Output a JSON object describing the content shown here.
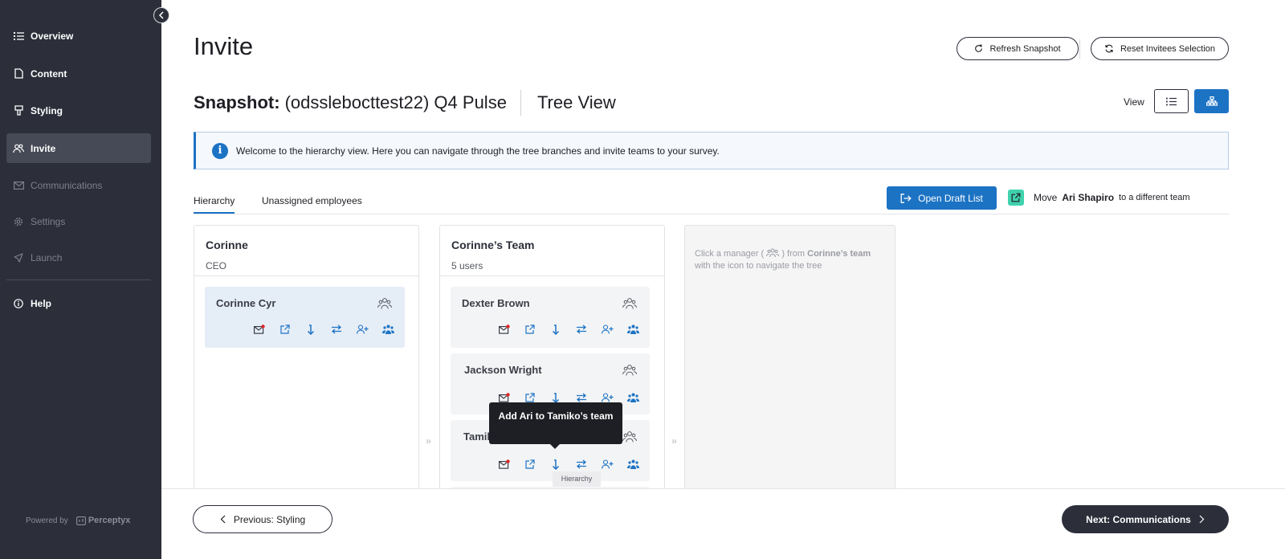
{
  "sidebar": {
    "items": [
      {
        "label": "Overview",
        "icon": "list-icon",
        "state": "normal"
      },
      {
        "label": "Content",
        "icon": "document-icon",
        "state": "normal"
      },
      {
        "label": "Styling",
        "icon": "brush-icon",
        "state": "normal"
      },
      {
        "label": "Invite",
        "icon": "people-icon",
        "state": "active"
      },
      {
        "label": "Communications",
        "icon": "mail-icon",
        "state": "disabled"
      },
      {
        "label": "Settings",
        "icon": "gear-icon",
        "state": "disabled"
      },
      {
        "label": "Launch",
        "icon": "rocket-icon",
        "state": "disabled"
      },
      {
        "label": "Help",
        "icon": "info-icon",
        "state": "normal"
      }
    ],
    "powered_by": "Powered by",
    "brand": "Perceptyx"
  },
  "header": {
    "title": "Invite",
    "refresh_label": "Refresh Snapshot",
    "reset_label": "Reset Invitees Selection"
  },
  "snapshot": {
    "label": "Snapshot:",
    "name": "(odsslebocttest22) Q4 Pulse",
    "view_name": "Tree View"
  },
  "view_toggle": {
    "label": "View",
    "selected": "tree"
  },
  "banner": {
    "text": "Welcome to the hierarchy view. Here you can navigate through the tree branches and invite teams to your survey."
  },
  "tabs": [
    {
      "label": "Hierarchy",
      "active": true
    },
    {
      "label": "Unassigned employees",
      "active": false
    }
  ],
  "draft_button": {
    "label": "Open Draft List"
  },
  "move": {
    "prefix": "Move",
    "name": "Ari Shapiro",
    "suffix": "to a different team"
  },
  "columns": [
    {
      "title": "Corinne",
      "subtitle": "CEO",
      "cards": [
        {
          "name": "Corinne Cyr",
          "selected": true
        }
      ]
    },
    {
      "title": "Corinne’s Team",
      "subtitle": "5 users",
      "cards": [
        {
          "name": "Dexter Brown",
          "selected": false
        },
        {
          "name": "Jackson Wright",
          "selected": false
        },
        {
          "name": "Tamiko",
          "selected": false
        }
      ]
    }
  ],
  "placeholder": {
    "part1": "Click a manager (",
    "part2": ") from",
    "bold": "Corinne’s team",
    "part3": "with the icon to navigate the tree"
  },
  "tooltip": {
    "text": "Add Ari to Tamiko’s team",
    "hint": "Hierarchy"
  },
  "footer": {
    "prev_label": "Previous: Styling",
    "next_label": "Next: Communications"
  },
  "colors": {
    "accent": "#1c73c4",
    "sidebar": "#2c2f3a",
    "teal": "#3fd2ad",
    "alert": "#e02424"
  }
}
